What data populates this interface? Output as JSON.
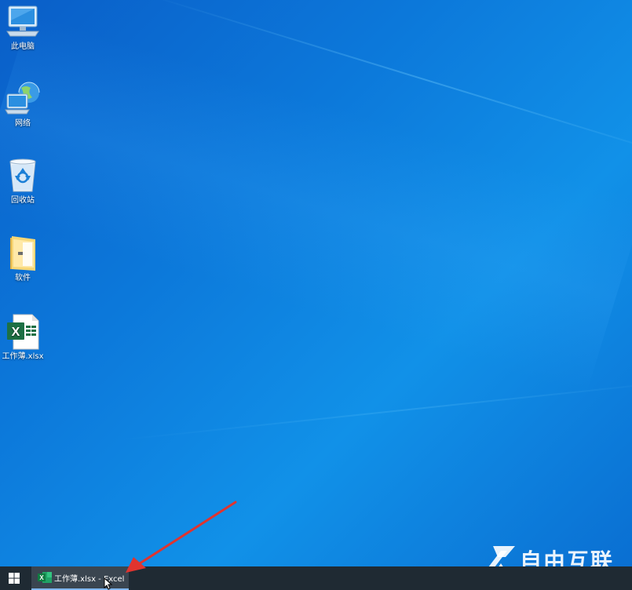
{
  "desktop": {
    "icons": [
      {
        "label": "此电脑",
        "icon": "computer-icon"
      },
      {
        "label": "网络",
        "icon": "network-icon"
      },
      {
        "label": "回收站",
        "icon": "recycle-bin-icon"
      },
      {
        "label": "软件",
        "icon": "folder-icon"
      },
      {
        "label": "工作薄.xlsx",
        "icon": "excel-file-icon"
      }
    ]
  },
  "taskbar": {
    "start_icon": "windows-logo-icon",
    "task_button": {
      "label": "工作薄.xlsx - Excel",
      "icon": "excel-icon"
    }
  },
  "watermark": {
    "text": "自由互联"
  },
  "colors": {
    "desktop_blue": "#0c78da",
    "taskbar": "#1f2a33",
    "arrow": "#e0342f",
    "excel_green": "#1d7044"
  }
}
